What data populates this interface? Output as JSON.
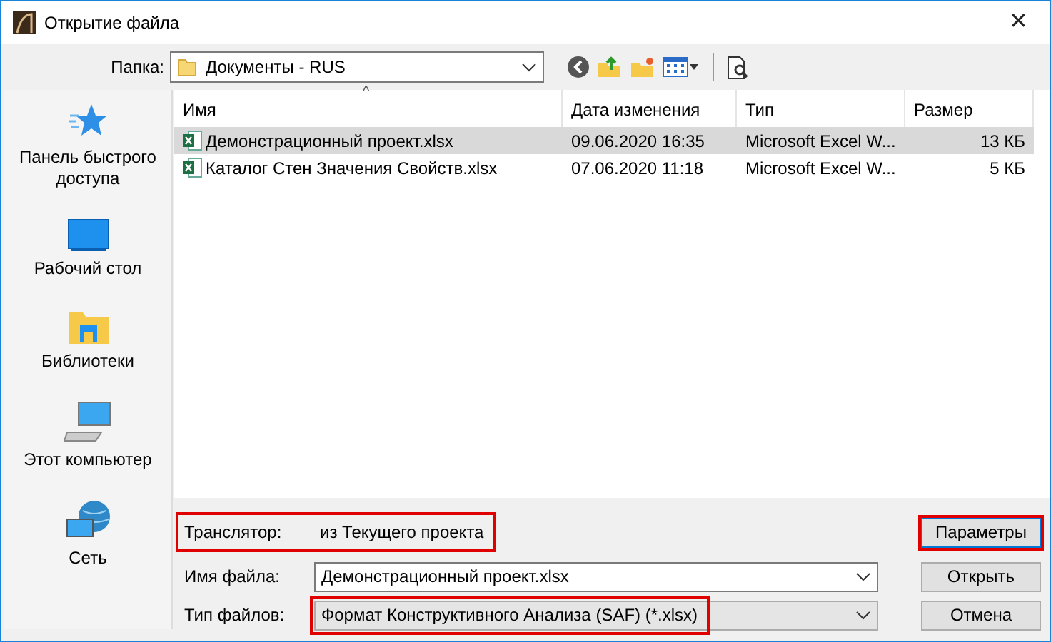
{
  "window": {
    "title": "Открытие файла",
    "close": "✕"
  },
  "folder": {
    "label": "Папка:",
    "value": "Документы - RUS"
  },
  "sidebar": {
    "items": [
      {
        "label": "Панель быстрого доступа",
        "kind": "star"
      },
      {
        "label": "Рабочий стол",
        "kind": "desktop"
      },
      {
        "label": "Библиотеки",
        "kind": "library"
      },
      {
        "label": "Этот компьютер",
        "kind": "computer"
      },
      {
        "label": "Сеть",
        "kind": "network"
      }
    ]
  },
  "table": {
    "sort_mark": "^",
    "columns": [
      "Имя",
      "Дата изменения",
      "Тип",
      "Размер"
    ],
    "rows": [
      {
        "cells": [
          "Демонстрационный проект.xlsx",
          "09.06.2020 16:35",
          "Microsoft Excel W...",
          "13 КБ"
        ],
        "selected": true
      },
      {
        "cells": [
          "Каталог Стен Значения Свойств.xlsx",
          "07.06.2020 11:18",
          "Microsoft Excel W...",
          "5 КБ"
        ],
        "selected": false
      }
    ]
  },
  "translator": {
    "label": "Транслятор:",
    "value": "из Текущего проекта",
    "highlighted": true
  },
  "filename": {
    "label": "Имя файла:",
    "value": "Демонстрационный проект.xlsx",
    "highlighted": false
  },
  "filetype": {
    "label": "Тип файлов:",
    "value": "Формат Конструктивного Анализа (SAF) (*.xlsx)",
    "highlighted": true
  },
  "buttons": [
    {
      "label": "Параметры",
      "highlighted": true
    },
    {
      "label": "Открыть",
      "highlighted": false
    },
    {
      "label": "Отмена",
      "highlighted": false
    }
  ]
}
